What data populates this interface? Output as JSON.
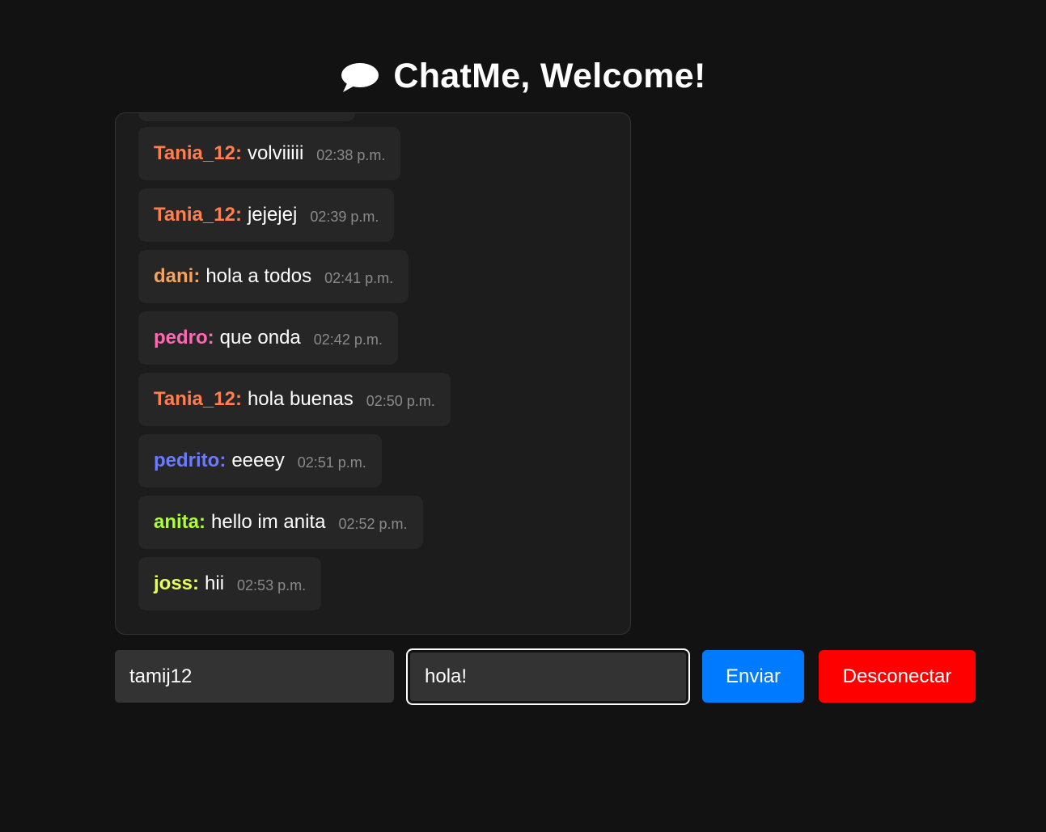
{
  "header": {
    "title": "ChatMe, Welcome!",
    "icon": "speech-bubble-icon"
  },
  "messages": [
    {
      "user": "Tania_12:",
      "text": "volviiiii",
      "time": "02:38 p.m.",
      "color": "#ff7f50"
    },
    {
      "user": "Tania_12:",
      "text": "jejejej",
      "time": "02:39 p.m.",
      "color": "#ff7f50"
    },
    {
      "user": "dani:",
      "text": "hola a todos",
      "time": "02:41 p.m.",
      "color": "#f4a460"
    },
    {
      "user": "pedro:",
      "text": "que onda",
      "time": "02:42 p.m.",
      "color": "#ff69b4"
    },
    {
      "user": "Tania_12:",
      "text": "hola buenas",
      "time": "02:50 p.m.",
      "color": "#ff7f50"
    },
    {
      "user": "pedrito:",
      "text": "eeeey",
      "time": "02:51 p.m.",
      "color": "#6b7bff"
    },
    {
      "user": "anita:",
      "text": "hello im anita",
      "time": "02:52 p.m.",
      "color": "#adff2f"
    },
    {
      "user": "joss:",
      "text": "hii",
      "time": "02:53 p.m.",
      "color": "#e6ff5c"
    }
  ],
  "composer": {
    "username_value": "tamij12",
    "message_value": "hola!",
    "send_label": "Enviar",
    "disconnect_label": "Desconectar"
  },
  "colors": {
    "background": "#121212",
    "send_button": "#007bff",
    "disconnect_button": "#ff0000"
  }
}
